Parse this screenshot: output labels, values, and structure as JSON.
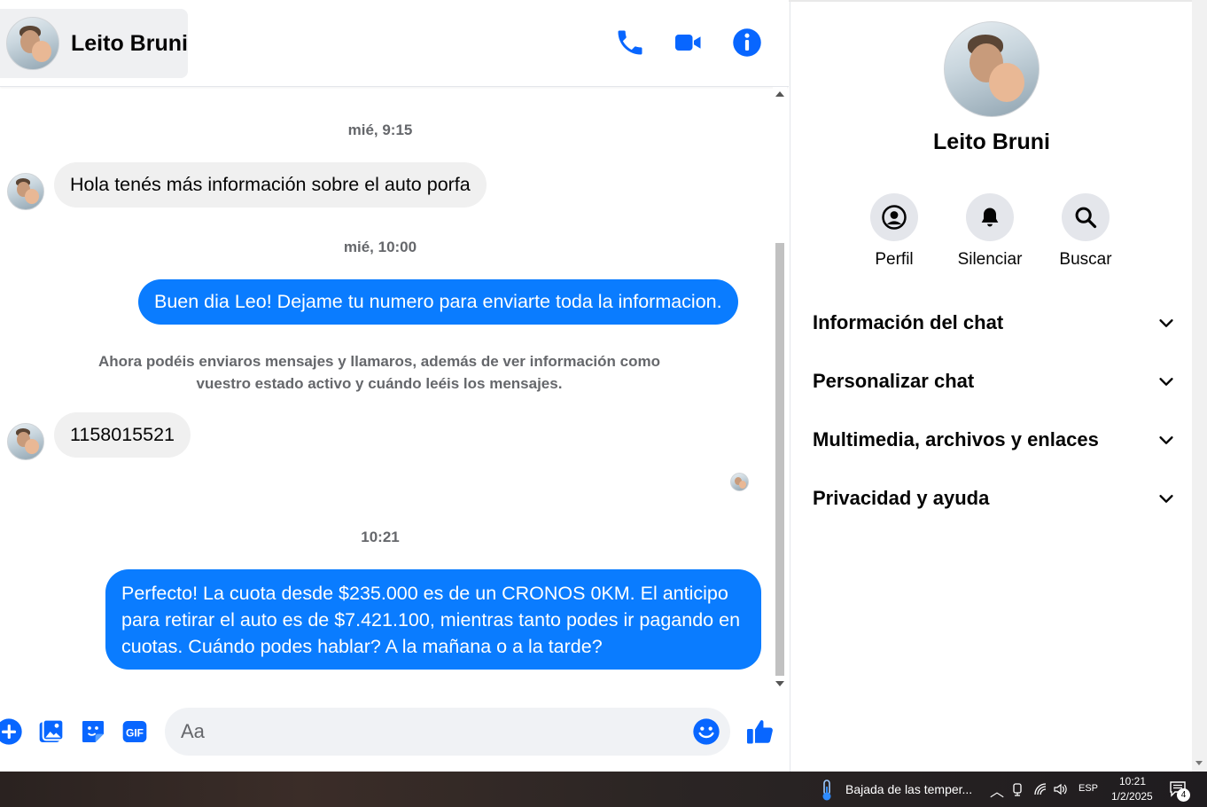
{
  "header": {
    "contact_name": "Leito Bruni",
    "icons": [
      "phone-icon",
      "video-icon",
      "info-icon"
    ]
  },
  "messages": {
    "timestamp_1": "mié, 9:15",
    "incoming_1": "Hola tenés más información sobre el auto porfa",
    "timestamp_2": "mié, 10:00",
    "outgoing_1": "Buen dia Leo! Dejame tu numero para enviarte toda la informacion.",
    "system_note": "Ahora podéis enviaros mensajes y llamaros, además de ver información como vuestro estado activo y cuándo leéis los mensajes.",
    "incoming_2": "1158015521",
    "timestamp_3": "10:21",
    "outgoing_2": "Perfecto! La cuota desde $235.000 es de un CRONOS 0KM. El anticipo para retirar el auto es de $7.421.100, mientras tanto podes ir pagando en cuotas. Cuándo podes hablar? A la mañana o a la tarde?"
  },
  "composer": {
    "placeholder": "Aa",
    "icons": [
      "plus-icon",
      "image-icon",
      "sticker-icon",
      "gif-icon",
      "emoji-icon",
      "like-icon"
    ]
  },
  "panel": {
    "name": "Leito Bruni",
    "actions": [
      {
        "label": "Perfil",
        "icon": "profile-icon"
      },
      {
        "label": "Silenciar",
        "icon": "bell-icon"
      },
      {
        "label": "Buscar",
        "icon": "search-icon"
      }
    ],
    "sections": [
      {
        "title": "Información del chat"
      },
      {
        "title": "Personalizar chat"
      },
      {
        "title": "Multimedia, archivos y enlaces"
      },
      {
        "title": "Privacidad y ayuda"
      }
    ]
  },
  "taskbar": {
    "weather": "Bajada de las temper...",
    "language": "ESP",
    "time": "10:21",
    "date": "1/2/2025",
    "notification_count": "4"
  },
  "colors": {
    "accent": "#0a7cff",
    "icon_blue": "#0866ff",
    "incoming_bubble": "#f0f0f0"
  }
}
